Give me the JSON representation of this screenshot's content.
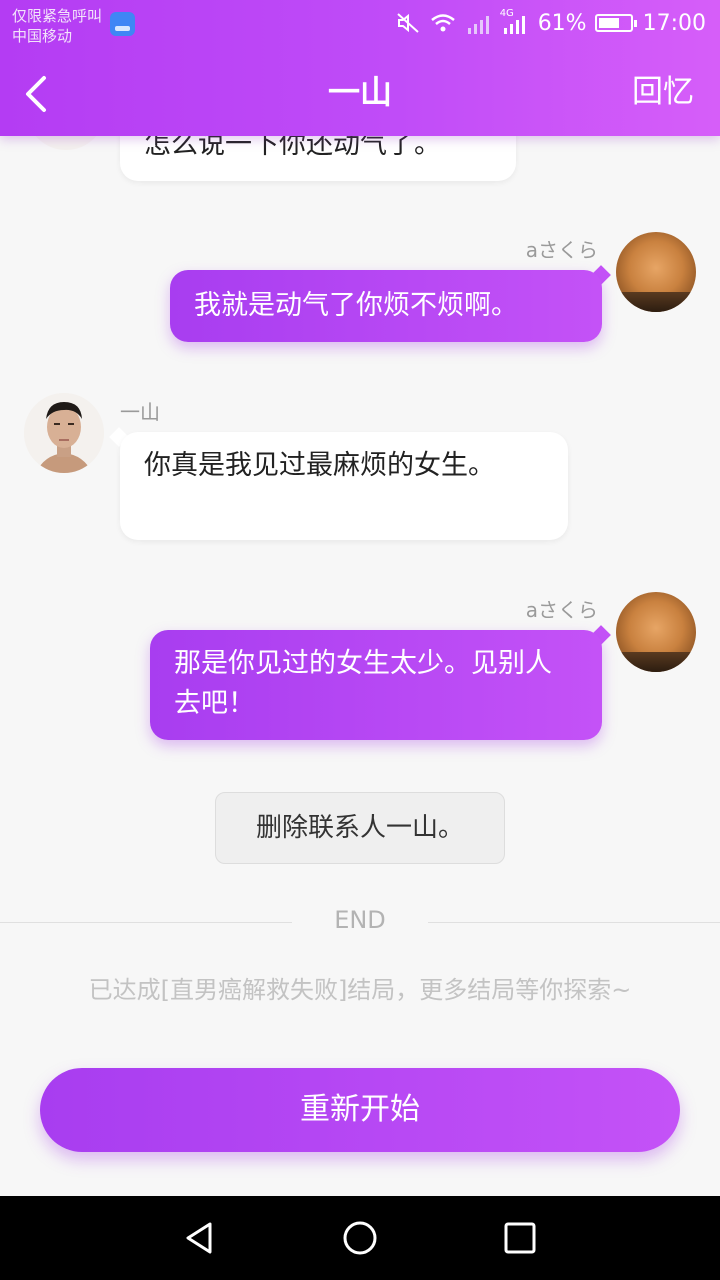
{
  "status_bar": {
    "line1": "仅限紧急呼叫",
    "line2": "中国移动",
    "network": "4G",
    "battery": "61%",
    "time": "17:00"
  },
  "nav": {
    "title": "一山",
    "right_action": "回忆",
    "back_icon": "chevron-left-icon"
  },
  "messages": [
    {
      "side": "left",
      "text": "怎么说一下你还动气了。"
    },
    {
      "side": "right",
      "sender": "aさくら",
      "text": "我就是动气了你烦不烦啊。"
    },
    {
      "side": "left",
      "sender": "一山",
      "text": "你真是我见过最麻烦的女生。"
    },
    {
      "side": "right",
      "sender": "aさくら",
      "text": "那是你见过的女生太少。见别人去吧！"
    }
  ],
  "system_message": "删除联系人一山。",
  "end_label": "END",
  "ending_note": "已达成[直男癌解救失败]结局，更多结局等你探索~",
  "restart_button": "重新开始",
  "colors": {
    "accent": "#b43cf3",
    "accent_light": "#c452f7",
    "background": "#f7f7f7"
  }
}
